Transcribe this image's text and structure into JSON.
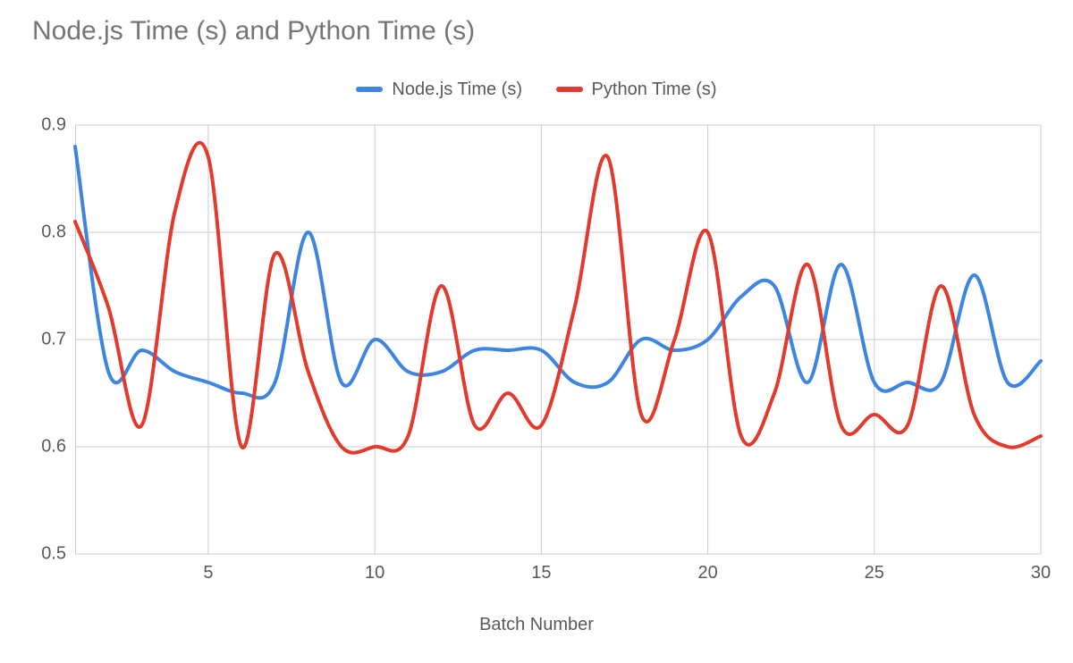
{
  "chart_data": {
    "type": "line",
    "title": "Node.js Time (s) and Python Time (s)",
    "xlabel": "Batch Number",
    "ylabel": "",
    "xlim": [
      1,
      30
    ],
    "ylim": [
      0.5,
      0.9
    ],
    "y_ticks": [
      0.5,
      0.6,
      0.7,
      0.8,
      0.9
    ],
    "x_ticks": [
      5,
      10,
      15,
      20,
      25,
      30
    ],
    "x": [
      1,
      2,
      3,
      4,
      5,
      6,
      7,
      8,
      9,
      10,
      11,
      12,
      13,
      14,
      15,
      16,
      17,
      18,
      19,
      20,
      21,
      22,
      23,
      24,
      25,
      26,
      27,
      28,
      29,
      30
    ],
    "series": [
      {
        "name": "Node.js Time (s)",
        "color": "#3d85e0",
        "values": [
          0.88,
          0.67,
          0.69,
          0.67,
          0.66,
          0.65,
          0.66,
          0.8,
          0.66,
          0.7,
          0.67,
          0.67,
          0.69,
          0.69,
          0.69,
          0.66,
          0.66,
          0.7,
          0.69,
          0.7,
          0.74,
          0.75,
          0.66,
          0.77,
          0.66,
          0.66,
          0.66,
          0.76,
          0.66,
          0.68
        ]
      },
      {
        "name": "Python Time (s)",
        "color": "#e23b2e",
        "values": [
          0.81,
          0.73,
          0.62,
          0.82,
          0.87,
          0.6,
          0.78,
          0.67,
          0.6,
          0.6,
          0.61,
          0.75,
          0.62,
          0.65,
          0.62,
          0.73,
          0.87,
          0.63,
          0.7,
          0.8,
          0.61,
          0.65,
          0.77,
          0.62,
          0.63,
          0.62,
          0.75,
          0.63,
          0.6,
          0.61
        ]
      }
    ]
  }
}
